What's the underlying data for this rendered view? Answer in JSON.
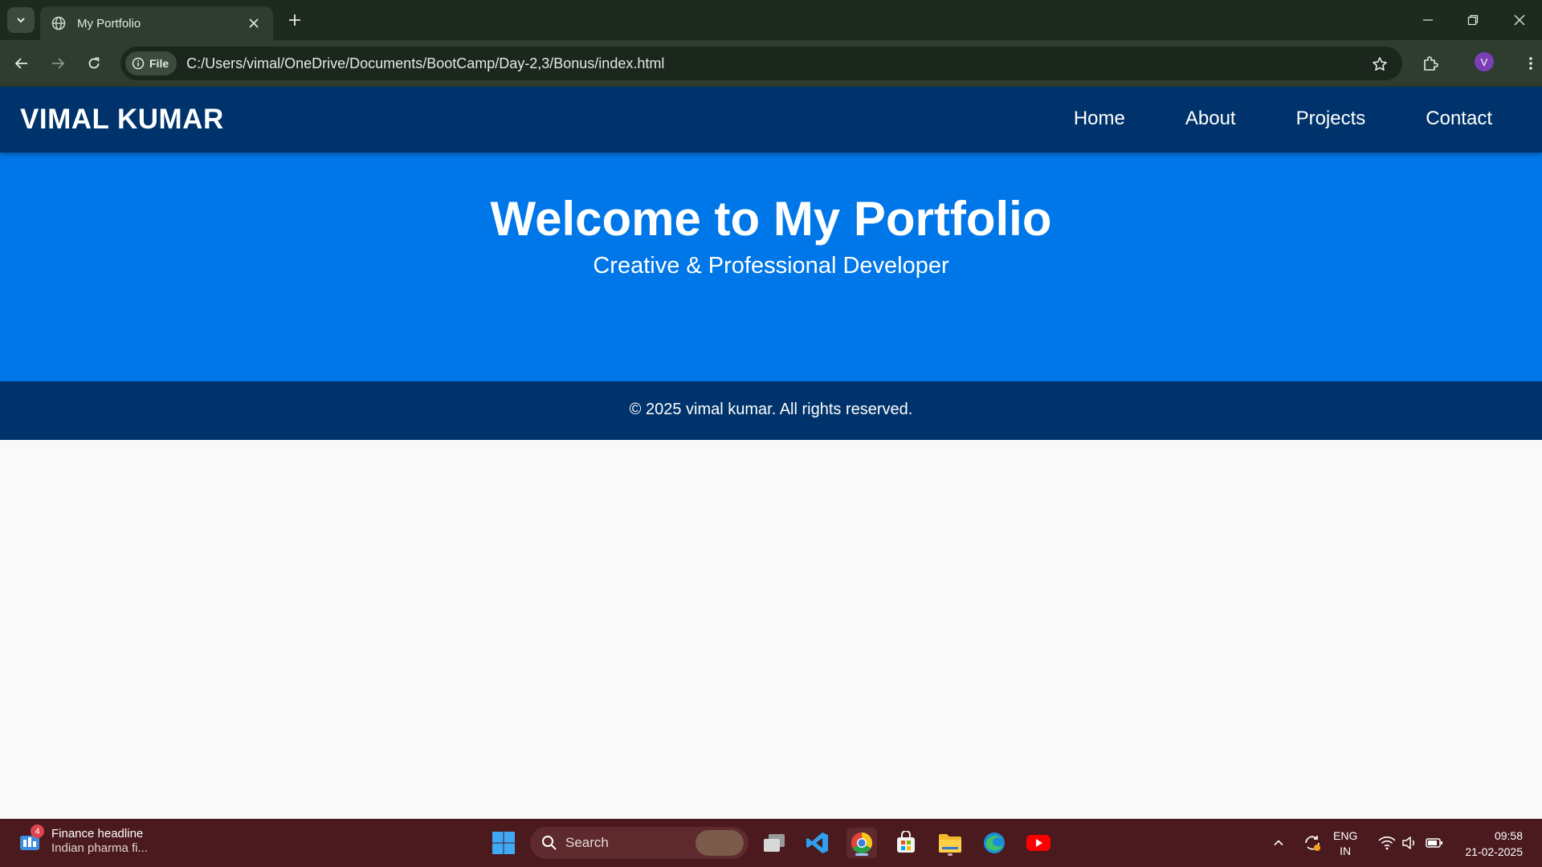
{
  "browser": {
    "tab_title": "My Portfolio",
    "url_chip": "File",
    "url": "C:/Users/vimal/OneDrive/Documents/BootCamp/Day-2,3/Bonus/index.html",
    "profile_initial": "V"
  },
  "site": {
    "logo": "VIMAL KUMAR",
    "nav": [
      "Home",
      "About",
      "Projects",
      "Contact"
    ],
    "hero_title": "Welcome to My Portfolio",
    "hero_subtitle": "Creative & Professional Developer",
    "footer": "© 2025 vimal kumar. All rights reserved."
  },
  "taskbar": {
    "news_badge": "4",
    "news_title": "Finance headline",
    "news_sub": "Indian pharma fi...",
    "search_label": "Search",
    "lang_top": "ENG",
    "lang_bottom": "IN",
    "time": "09:58",
    "date": "21-02-2025"
  },
  "colors": {
    "nav_bg": "#00336b",
    "hero_bg": "#0077e8",
    "footer_bg": "#00336b",
    "taskbar_bg": "#4a1a1e"
  }
}
